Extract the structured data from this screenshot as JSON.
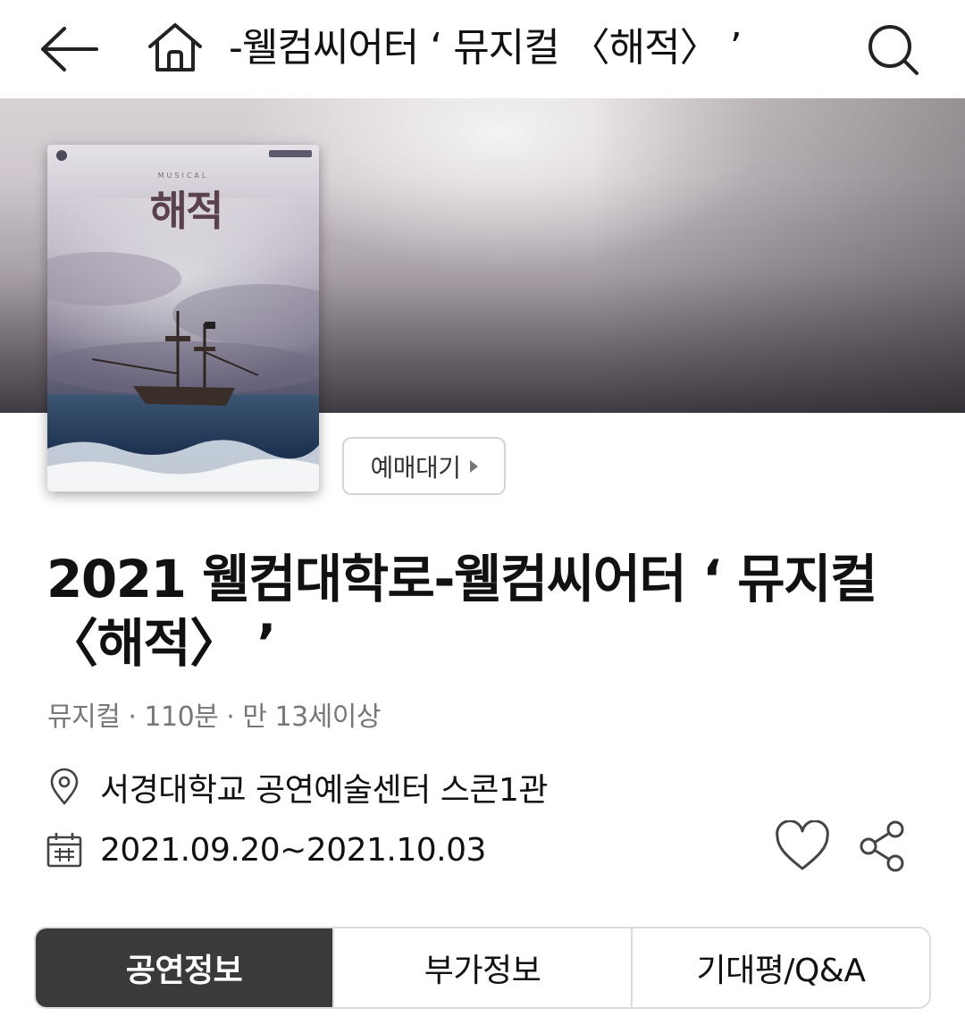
{
  "header": {
    "title": "-웰컴씨어터 ‘ 뮤지컬 〈해적〉 ’"
  },
  "poster": {
    "tag": "MUSICAL",
    "title": "해적"
  },
  "presale": {
    "label": "예매대기"
  },
  "event": {
    "title": "2021 웰컴대학로-웰컴씨어터 ‘ 뮤지컬 〈해적〉 ’",
    "meta": "뮤지컬 · 110분 · 만 13세이상",
    "venue": "서경대학교 공연예술센터 스콘1관",
    "dates": "2021.09.20~2021.10.03"
  },
  "tabs": [
    {
      "label": "공연정보",
      "active": true
    },
    {
      "label": "부가정보",
      "active": false
    },
    {
      "label": "기대평/Q&A",
      "active": false
    }
  ],
  "icons": {
    "back": "arrow-left-icon",
    "home": "home-icon",
    "search": "search-icon",
    "venue": "location-pin-icon",
    "date": "calendar-icon",
    "like": "heart-icon",
    "share": "share-icon"
  },
  "colors": {
    "active_tab_bg": "#3a3a3a",
    "muted_text": "#777777",
    "border": "#dcdcdc"
  }
}
